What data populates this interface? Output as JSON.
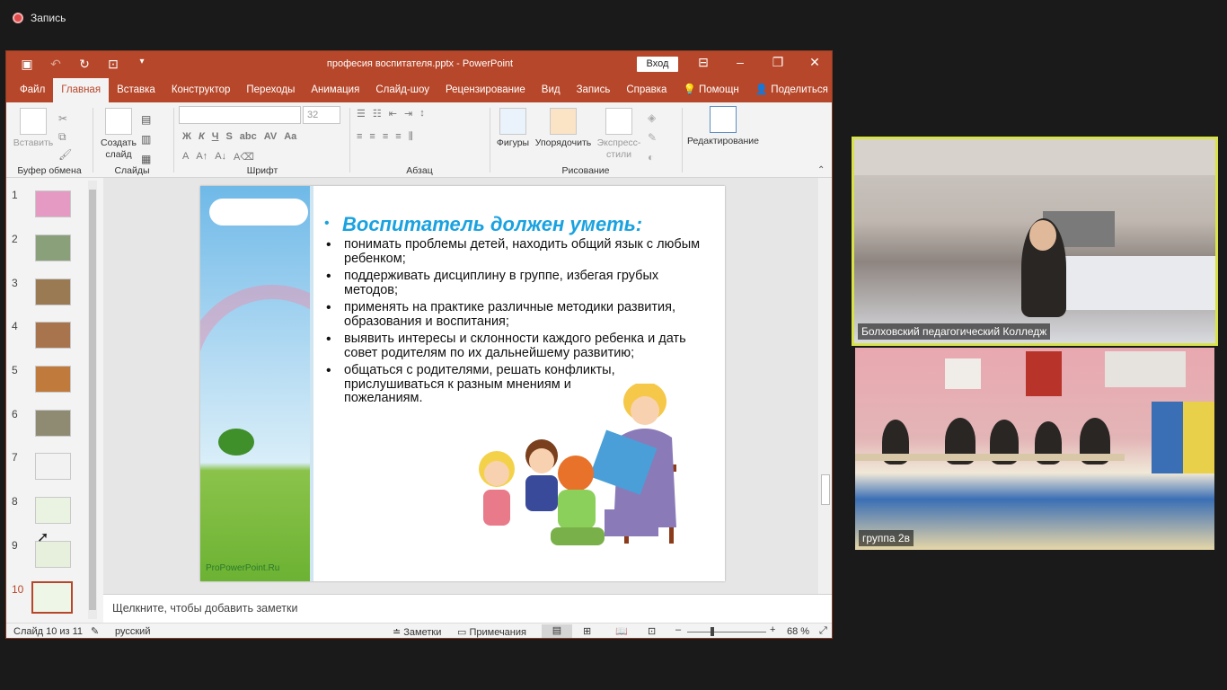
{
  "recording": {
    "label": "Запись"
  },
  "ppt": {
    "title": "професия воспитателя.pptx  -  PowerPoint",
    "signin": "Вход",
    "tabs": [
      "Файл",
      "Главная",
      "Вставка",
      "Конструктор",
      "Переходы",
      "Анимация",
      "Слайд-шоу",
      "Рецензирование",
      "Вид",
      "Запись",
      "Справка",
      "Помощн",
      "Поделиться"
    ],
    "active_tab_index": 1,
    "ribbon": {
      "clipboard": {
        "label": "Буфер обмена",
        "paste": "Вставить"
      },
      "slides": {
        "label": "Слайды",
        "new_slide": "Создать слайд"
      },
      "font": {
        "label": "Шрифт",
        "size": "32"
      },
      "paragraph": {
        "label": "Абзац"
      },
      "drawing": {
        "label": "Рисование",
        "shapes": "Фигуры",
        "arrange": "Упорядочить",
        "styles": "Экспресс-стили"
      },
      "editing": {
        "label": "Редактирование"
      }
    },
    "slide_numbers": [
      "1",
      "2",
      "3",
      "4",
      "5",
      "6",
      "7",
      "8",
      "9",
      "10"
    ],
    "current_slide_index": 9,
    "slide": {
      "heading": "Воспитатель должен уметь:",
      "bullets": [
        "понимать проблемы детей, находить общий язык с любым ребенком;",
        "поддерживать дисциплину в группе, избегая грубых методов;",
        "применять на практике различные методики развития, образования и воспитания;",
        "выявить интересы и склонности каждого ребенка и дать совет родителям по их дальнейшему развитию;",
        "общаться с родителями, решать конфликты, прислушиваться к разным мнениям и пожеланиям."
      ],
      "brand": "ProPowerPoint.Ru"
    },
    "notes_placeholder": "Щелкните, чтобы добавить заметки",
    "status": {
      "slide_count": "Слайд 10 из 11",
      "language": "русский",
      "notes": "Заметки",
      "comments": "Примечания",
      "zoom": "68 %"
    }
  },
  "video": {
    "tile1_name": "Болховский педагогический Колледж",
    "tile2_name": "группа 2в",
    "active_border_color": "#d8e34a"
  }
}
